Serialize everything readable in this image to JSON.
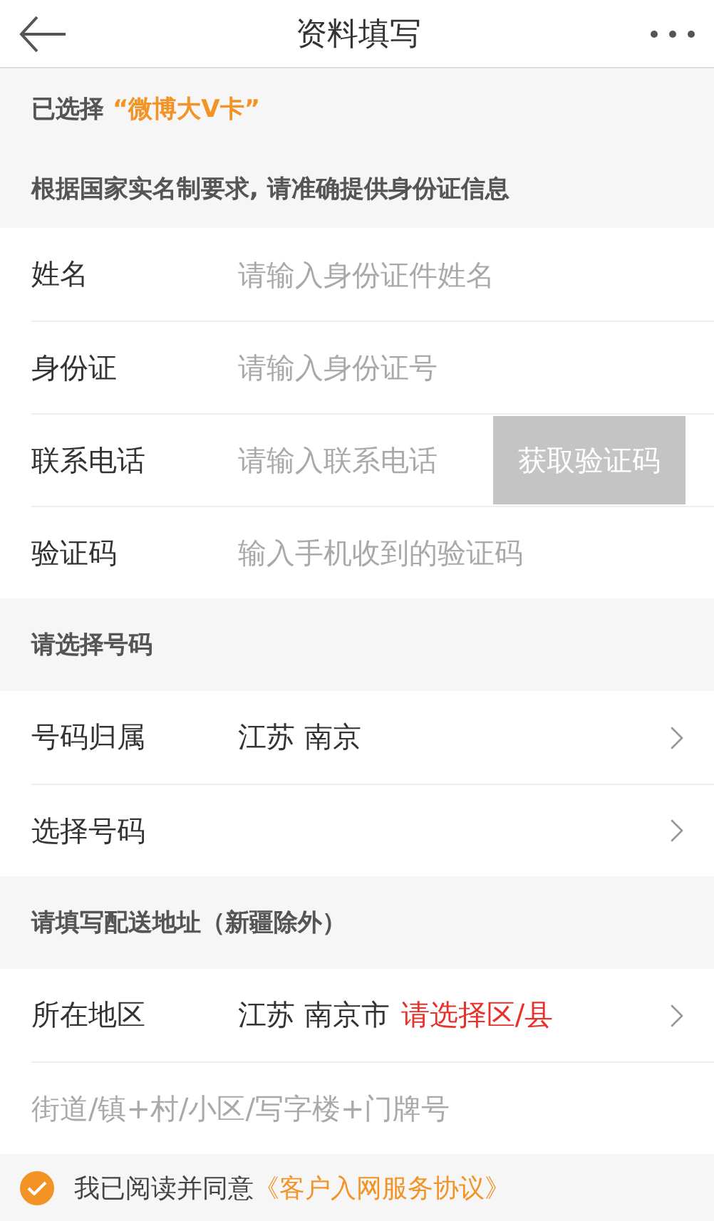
{
  "header": {
    "title": "资料填写"
  },
  "intro": {
    "selection_label": "已选择",
    "selection_value": "“微博大V卡”",
    "notice": "根据国家实名制要求, 请准确提供身份证信息"
  },
  "id_rows": [
    {
      "label": "姓名",
      "placeholder": "请输入身份证件姓名"
    },
    {
      "label": "身份证",
      "placeholder": "请输入身份证号"
    },
    {
      "label": "联系电话",
      "placeholder": "请输入联系电话",
      "button": "获取验证码"
    },
    {
      "label": "验证码",
      "placeholder": "输入手机收到的验证码"
    }
  ],
  "sections": [
    {
      "title": "请选择号码",
      "rows": [
        {
          "label": "号码归属",
          "value": "江苏 南京"
        },
        {
          "label": "选择号码"
        }
      ]
    },
    {
      "title": "请填写配送地址（新疆除外）",
      "rows": [
        {
          "label": "所在地区",
          "value": "江苏 南京市",
          "hint": "请选择区/县"
        }
      ]
    }
  ],
  "address": {
    "placeholder": "街道/镇+村/小区/写字楼+门牌号"
  },
  "agreement": {
    "checked": true,
    "text": "我已阅读并同意",
    "link": "《客户入网服务协议》"
  }
}
